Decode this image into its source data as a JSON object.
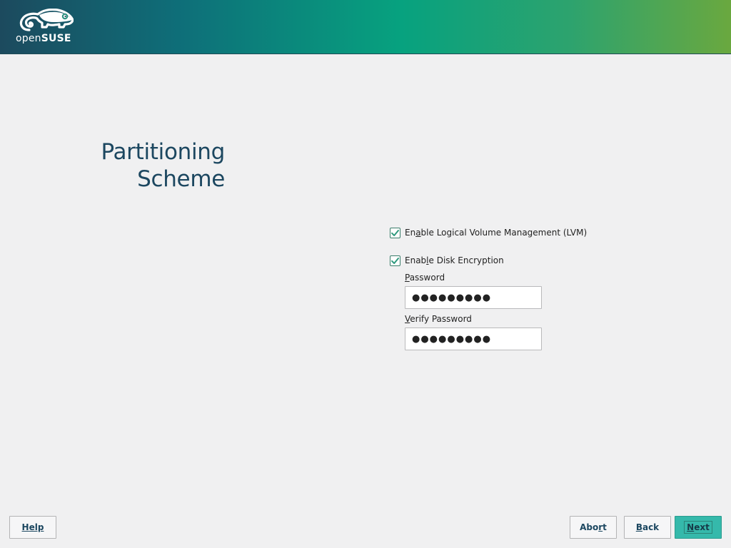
{
  "header": {
    "logo_text_light": "open",
    "logo_text_bold": "SUSE",
    "logo_icon": "chameleon-logo-icon"
  },
  "page": {
    "title_line1": "Partitioning",
    "title_line2": "Scheme"
  },
  "options": {
    "lvm": {
      "checked": true,
      "label_pre": "En",
      "label_mnemonic": "a",
      "label_post": "ble Logical Volume Management (LVM)"
    },
    "encryption": {
      "checked": true,
      "label_pre": "Enab",
      "label_mnemonic": "l",
      "label_post": "e Disk Encryption"
    }
  },
  "password": {
    "label_mnemonic": "P",
    "label_rest": "assword",
    "value": "●●●●●●●●●"
  },
  "verify_password": {
    "label_mnemonic": "V",
    "label_rest": "erify Password",
    "value": "●●●●●●●●●"
  },
  "buttons": {
    "help": {
      "mnemonic": "H",
      "rest": "elp"
    },
    "abort": {
      "pre": "Abo",
      "mnemonic": "r",
      "post": "t"
    },
    "back": {
      "mnemonic": "B",
      "rest": "ack"
    },
    "next": {
      "mnemonic": "N",
      "rest": "ext"
    }
  },
  "colors": {
    "accent": "#35b9ab",
    "title": "#1c4760",
    "check": "#2f9a7e"
  }
}
